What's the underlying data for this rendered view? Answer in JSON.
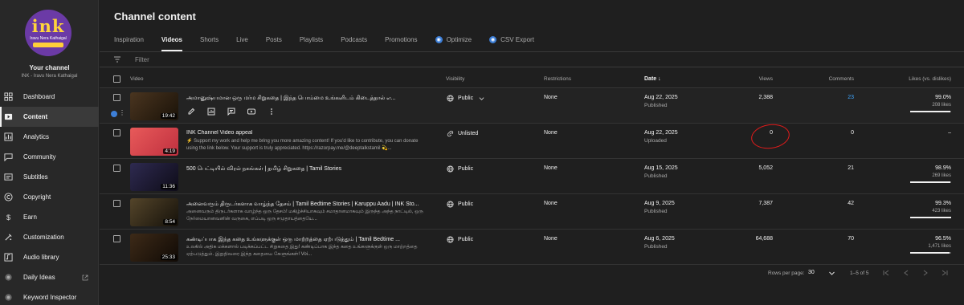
{
  "sidebar": {
    "logo_word": "ink",
    "logo_tagline": "Iravu Nera Kathaigal",
    "your_channel": "Your channel",
    "channel_name": "INK - Iravu Nera Kathaigal",
    "items": [
      {
        "label": "Dashboard",
        "icon": "dashboard-icon"
      },
      {
        "label": "Content",
        "icon": "content-icon",
        "active": true
      },
      {
        "label": "Analytics",
        "icon": "analytics-icon"
      },
      {
        "label": "Community",
        "icon": "community-icon"
      },
      {
        "label": "Subtitles",
        "icon": "subtitles-icon"
      },
      {
        "label": "Copyright",
        "icon": "copyright-icon"
      },
      {
        "label": "Earn",
        "icon": "earn-icon"
      },
      {
        "label": "Customization",
        "icon": "customization-icon"
      },
      {
        "label": "Audio library",
        "icon": "audio-library-icon"
      },
      {
        "label": "Daily Ideas",
        "icon": "daily-ideas-icon"
      },
      {
        "label": "Keyword Inspector",
        "icon": "keyword-inspector-icon"
      }
    ]
  },
  "header": {
    "title": "Channel content",
    "tabs": [
      {
        "label": "Inspiration"
      },
      {
        "label": "Videos",
        "active": true
      },
      {
        "label": "Shorts"
      },
      {
        "label": "Live"
      },
      {
        "label": "Posts"
      },
      {
        "label": "Playlists"
      },
      {
        "label": "Podcasts"
      },
      {
        "label": "Promotions"
      },
      {
        "label": "Optimize",
        "badge": true
      },
      {
        "label": "CSV Export",
        "badge": true
      }
    ]
  },
  "filter": {
    "placeholder": "Filter"
  },
  "table": {
    "headers": {
      "video": "Video",
      "visibility": "Visibility",
      "restrictions": "Restrictions",
      "date": "Date",
      "views": "Views",
      "comments": "Comments",
      "likes": "Likes (vs. dislikes)"
    },
    "rows": [
      {
        "title": "அமானுஷ்யமான ஒரு மர்ம சிறுகதை | இந்த பொம்மை உங்களிடம் கிடைத்தால் எ...",
        "description": "",
        "duration": "19:42",
        "visibility": "Public",
        "restrictions": "None",
        "date": "Aug 22, 2025",
        "status": "Published",
        "views": "2,388",
        "comments": "23",
        "likes_pct": "99.0%",
        "likes_count": "208 likes",
        "likes_fraction": 0.99,
        "thumb_color": "#3a2a1a",
        "hover": true
      },
      {
        "title": "INK Channel Video appeal",
        "description": "⚡ Support my work and help me bring you more amazing content! If you'd like to contribute, you can donate using the link below. Your support is truly appreciated. https://razorpay.me/@deeptalkstamil 💫...",
        "duration": "4:19",
        "visibility": "Unlisted",
        "restrictions": "None",
        "date": "Aug 22, 2025",
        "status": "Uploaded",
        "views": "0",
        "comments": "0",
        "likes_pct": "–",
        "likes_count": "",
        "thumb_color": "#d8434f"
      },
      {
        "title": "500 பெட்டியில் விரல் நகங்கள் | தமிழ் சிறுகதை | Tamil Stories",
        "description": "",
        "duration": "11:36",
        "visibility": "Public",
        "restrictions": "None",
        "date": "Aug 15, 2025",
        "status": "Published",
        "views": "5,052",
        "comments": "21",
        "likes_pct": "98.9%",
        "likes_count": "269 likes",
        "likes_fraction": 0.989,
        "thumb_color": "#1a1a2a"
      },
      {
        "title": "அனைவரும் திருடர்களாக வாழ்ந்த தேசம் | Tamil Bedtime Stories | Karuppu Aadu | INK Sto...",
        "description": "அனைவரும் திருடர்களாக வாழ்ந்த ஒரு தேசம்! மகிழ்ச்சியாகவும் சமாதானமாகவும் இருந்த அந்த நாட்டில், ஒரு நேர்மையானவனின் வருகை, எப்படி ஒரு சமுதாயத்தையே...",
        "duration": "8:54",
        "visibility": "Public",
        "restrictions": "None",
        "date": "Aug 9, 2025",
        "status": "Published",
        "views": "7,387",
        "comments": "42",
        "likes_pct": "99.3%",
        "likes_count": "423 likes",
        "likes_fraction": 0.993,
        "thumb_color": "#2a2418"
      },
      {
        "title": "கண்டிப்பாக இந்த கதை உங்களுக்குள் ஒரு மாற்றத்தை ஏற்படுத்தும் | Tamil Bedtime ...",
        "description": "உலகில் அதிக மக்களால் படிக்கப்பட்ட சிறுகதை இது! கண்டிப்பாக இந்த கதை உங்களுக்குள் ஒரு மாற்றத்தை ஏற்படுத்தும். இறுதிவரை இந்த கதையை கேளுங்கள்! Voi...",
        "duration": "25:33",
        "visibility": "Public",
        "restrictions": "None",
        "date": "Aug 6, 2025",
        "status": "Published",
        "views": "64,688",
        "comments": "70",
        "likes_pct": "96.5%",
        "likes_count": "1,471 likes",
        "likes_fraction": 0.965,
        "thumb_color": "#241a12"
      }
    ]
  },
  "pagination": {
    "rows_per_page_label": "Rows per page:",
    "rows_per_page": "30",
    "range": "1–5 of 5"
  }
}
